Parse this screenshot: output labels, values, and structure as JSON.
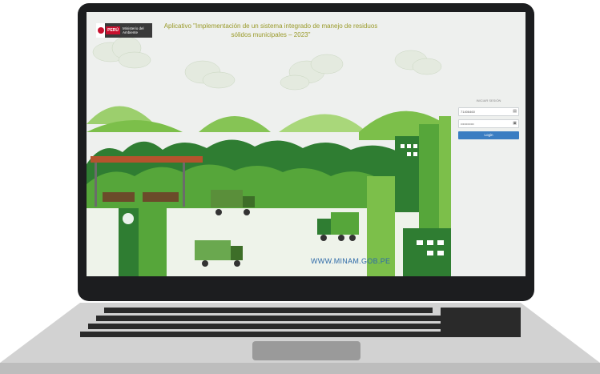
{
  "app": {
    "title": "Aplicativo \"Implementación de un sistema integrado de manejo de residuos sólidos municipales – 2023\"",
    "logo_country": "PERÚ",
    "logo_ministry": "Ministerio del Ambiente",
    "website": "WWW.MINAM.GOB.PE"
  },
  "login": {
    "heading": "INICIAR SESIÓN",
    "username_value": "71406460",
    "password_placeholder": "••••••••••••",
    "button_label": "Login"
  },
  "colors": {
    "accent": "#3a7dc2",
    "title": "#9a9a2a",
    "green_dark": "#2f7d32",
    "green_light": "#7cbf4a"
  }
}
